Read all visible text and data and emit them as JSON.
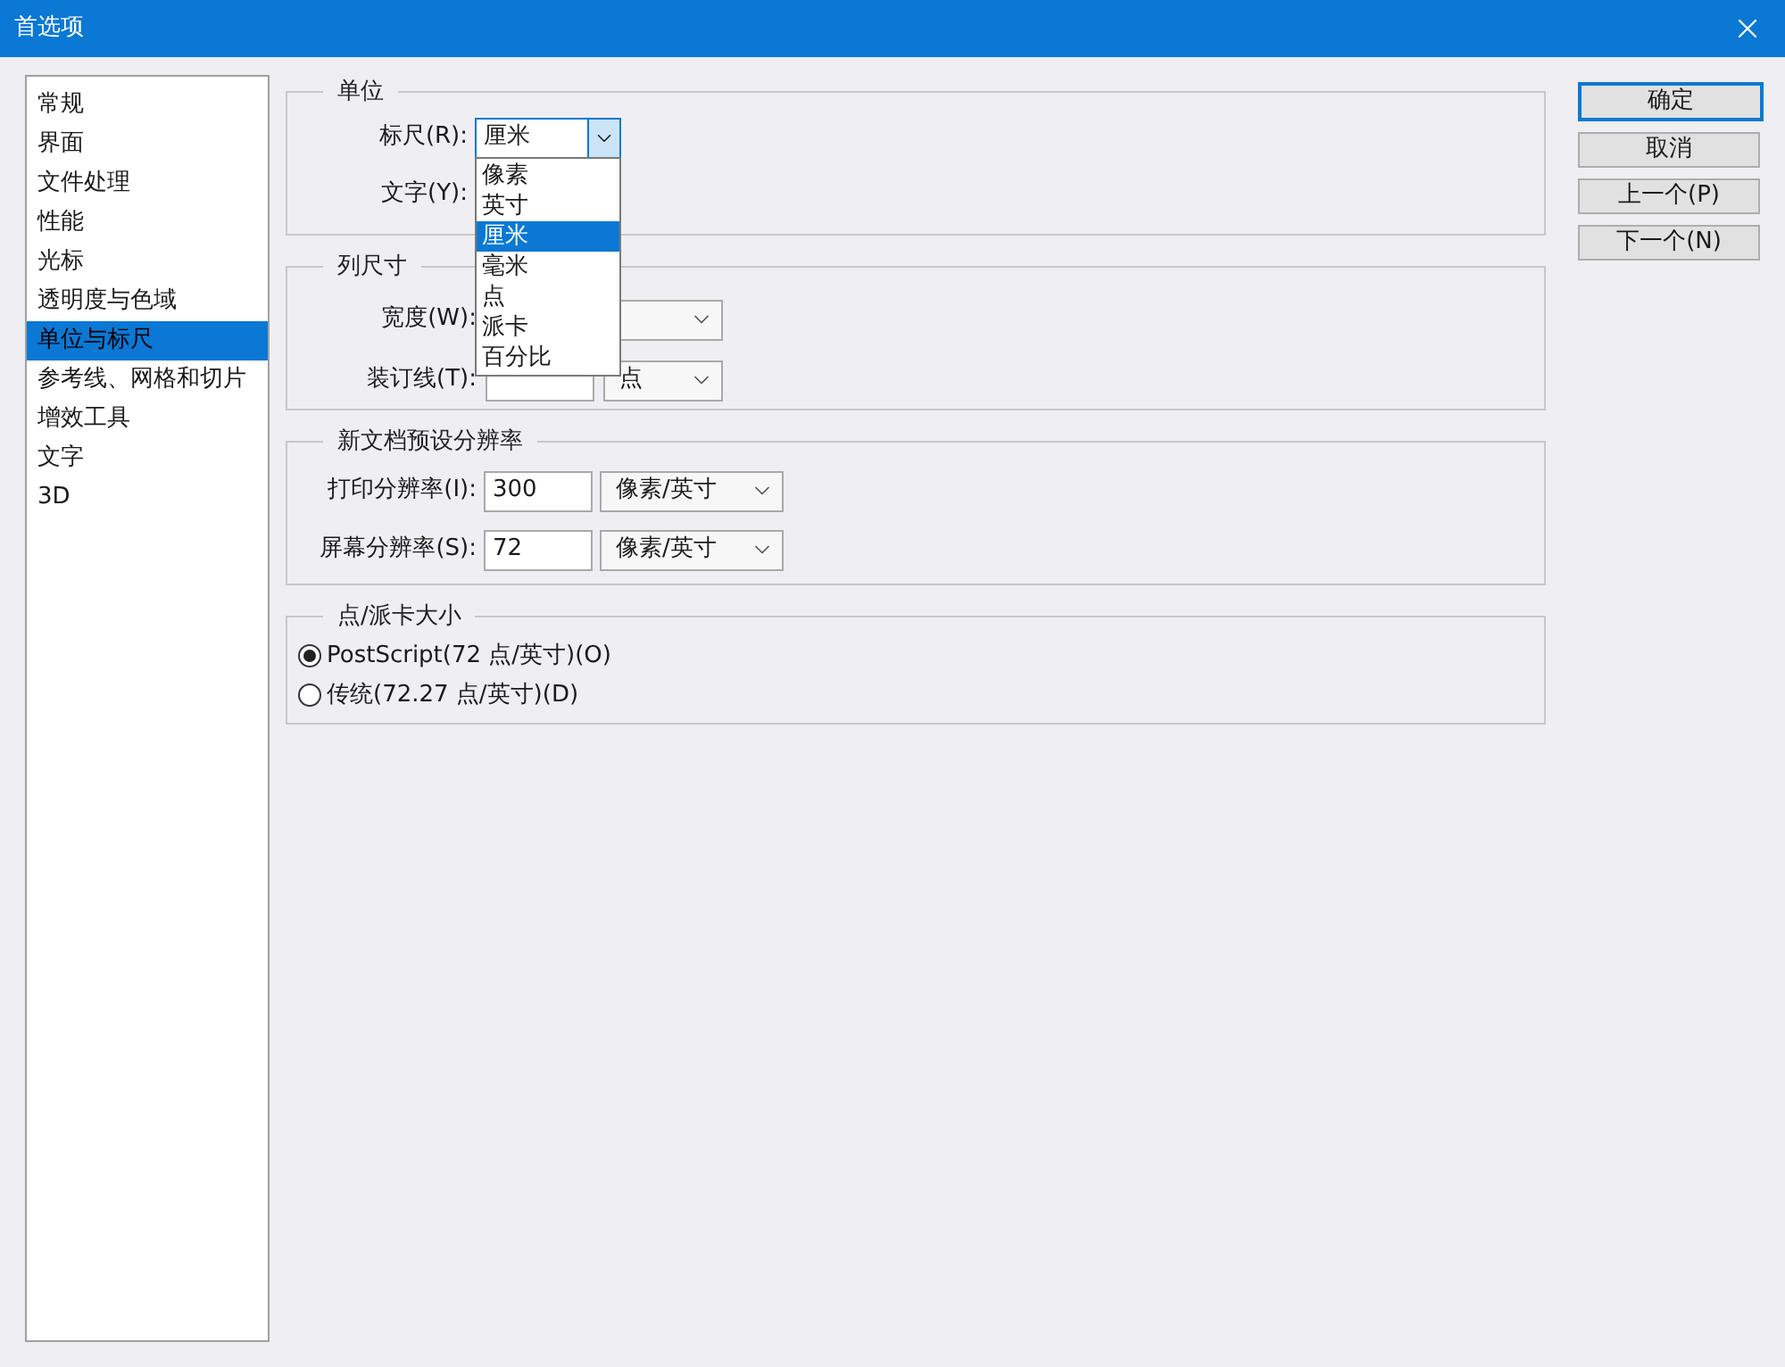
{
  "window": {
    "title": "首选项"
  },
  "sidebar": {
    "items": [
      {
        "label": "常规",
        "selected": false
      },
      {
        "label": "界面",
        "selected": false
      },
      {
        "label": "文件处理",
        "selected": false
      },
      {
        "label": "性能",
        "selected": false
      },
      {
        "label": "光标",
        "selected": false
      },
      {
        "label": "透明度与色域",
        "selected": false
      },
      {
        "label": "单位与标尺",
        "selected": true
      },
      {
        "label": "参考线、网格和切片",
        "selected": false
      },
      {
        "label": "增效工具",
        "selected": false
      },
      {
        "label": "文字",
        "selected": false
      },
      {
        "label": "3D",
        "selected": false
      }
    ]
  },
  "units": {
    "title": "单位",
    "ruler": {
      "label": "标尺(R):",
      "value": "厘米",
      "expanded": true,
      "options": [
        {
          "label": "像素",
          "selected": false
        },
        {
          "label": "英寸",
          "selected": false
        },
        {
          "label": "厘米",
          "selected": true
        },
        {
          "label": "毫米",
          "selected": false
        },
        {
          "label": "点",
          "selected": false
        },
        {
          "label": "派卡",
          "selected": false
        },
        {
          "label": "百分比",
          "selected": false
        }
      ]
    },
    "type": {
      "label": "文字(Y):"
    }
  },
  "column_size": {
    "title": "列尺寸",
    "rows": [
      {
        "label": "宽度(W):"
      },
      {
        "label": "装订线(T):",
        "unit": "点"
      }
    ]
  },
  "resolution": {
    "title": "新文档预设分辨率",
    "rows": [
      {
        "label": "打印分辨率(I):",
        "value": "300",
        "unit": "像素/英寸"
      },
      {
        "label": "屏幕分辨率(S):",
        "value": "72",
        "unit": "像素/英寸"
      }
    ]
  },
  "point_size": {
    "title": "点/派卡大小",
    "options": [
      {
        "label": "PostScript(72 点/英寸)(O)",
        "selected": true
      },
      {
        "label": "传统(72.27 点/英寸)(D)",
        "selected": false
      }
    ]
  },
  "buttons": [
    {
      "label": "确定",
      "default": true
    },
    {
      "label": "取消",
      "default": false
    },
    {
      "label": "上一个(P)",
      "default": false
    },
    {
      "label": "下一个(N)",
      "default": false
    }
  ]
}
